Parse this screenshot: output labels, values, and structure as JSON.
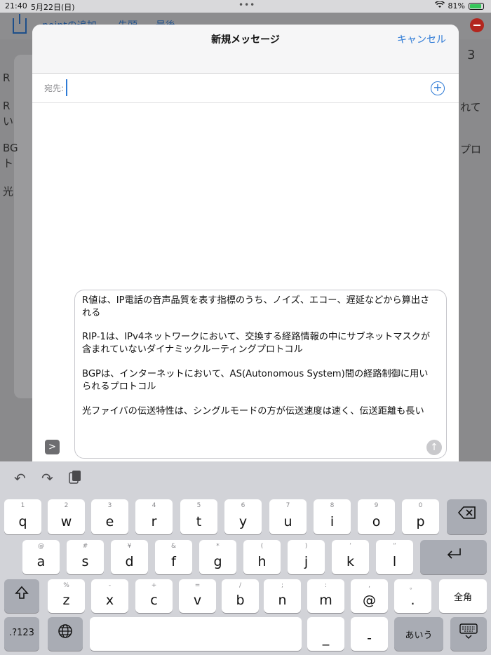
{
  "status": {
    "time": "21:40",
    "date": "5月22日(日)",
    "battery": "81%"
  },
  "background": {
    "toolbar_links": [
      "pointの追加",
      "先頭",
      "最後"
    ],
    "line_texts": [
      "R",
      "R",
      "い",
      "BG",
      "ト",
      "光"
    ],
    "right_texts": [
      "3",
      "れて",
      "プロ"
    ]
  },
  "sheet": {
    "title": "新規メッセージ",
    "cancel_label": "キャンセル",
    "to_label": "宛先:",
    "to_value": "",
    "add_label": "+",
    "message": {
      "p1": "R値は、IP電話の音声品質を表す指標のうち、ノイズ、エコー、遅延などから算出される",
      "p2": "RIP-1は、IPv4ネットワークにおいて、交換する経路情報の中にサブネットマスクが含まれていないダイナミックルーティングプロトコル",
      "p3": "BGPは、インターネットにおいて、AS(Autonomous System)間の経路制御に用いられるプロトコル",
      "p4": "光ファイバの伝送特性は、シングルモードの方が伝送速度は速く、伝送距離も長い"
    },
    "send_icon": "↑",
    "expand_icon": ">"
  },
  "keyboard": {
    "toolbar_icons": [
      "undo-icon",
      "redo-icon",
      "paste-icon"
    ],
    "row1": [
      {
        "main": "q",
        "sub": "1"
      },
      {
        "main": "w",
        "sub": "2"
      },
      {
        "main": "e",
        "sub": "3"
      },
      {
        "main": "r",
        "sub": "4"
      },
      {
        "main": "t",
        "sub": "5"
      },
      {
        "main": "y",
        "sub": "6"
      },
      {
        "main": "u",
        "sub": "7"
      },
      {
        "main": "i",
        "sub": "8"
      },
      {
        "main": "o",
        "sub": "9"
      },
      {
        "main": "p",
        "sub": "0"
      }
    ],
    "row2": [
      {
        "main": "a",
        "sub": "@"
      },
      {
        "main": "s",
        "sub": "#"
      },
      {
        "main": "d",
        "sub": "¥"
      },
      {
        "main": "f",
        "sub": "&"
      },
      {
        "main": "g",
        "sub": "*"
      },
      {
        "main": "h",
        "sub": "("
      },
      {
        "main": "j",
        "sub": ")"
      },
      {
        "main": "k",
        "sub": "’"
      },
      {
        "main": "l",
        "sub": "”"
      }
    ],
    "row3": [
      {
        "main": "z",
        "sub": "%"
      },
      {
        "main": "x",
        "sub": "-"
      },
      {
        "main": "c",
        "sub": "+"
      },
      {
        "main": "v",
        "sub": "="
      },
      {
        "main": "b",
        "sub": "/"
      },
      {
        "main": "n",
        "sub": ";"
      },
      {
        "main": "m",
        "sub": ":"
      },
      {
        "main": "@",
        "sub": ","
      },
      {
        "main": ".",
        "sub": "。"
      }
    ],
    "zenkaku_label": "全角",
    "numbers_label": ".?123",
    "underscore_label": "_",
    "dash_label": "-",
    "kana_label": "あいう",
    "space_label": ""
  }
}
